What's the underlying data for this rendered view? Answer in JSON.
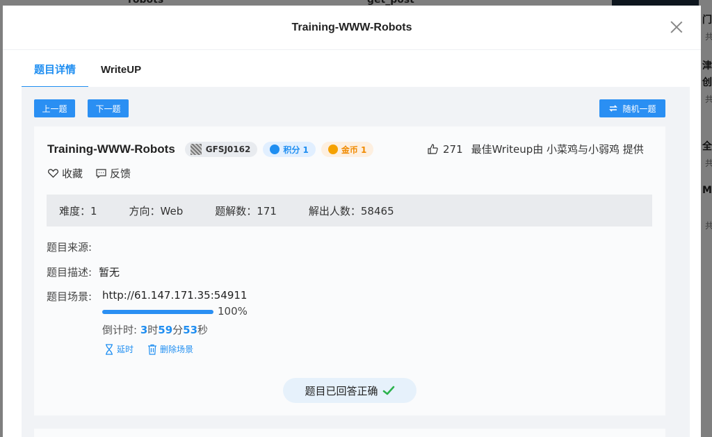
{
  "background": {
    "top_texts": [
      "robots",
      "get_post"
    ],
    "right_lines": [
      "门",
      "津",
      "创",
      "全",
      "M"
    ],
    "right_subs": [
      "共",
      "共",
      "共",
      "共"
    ]
  },
  "modal": {
    "title": "Training-WWW-Robots",
    "tabs": [
      {
        "label": "题目详情",
        "active": true
      },
      {
        "label": "WriteUP",
        "active": false
      }
    ],
    "toolbar": {
      "prev_label": "上一题",
      "next_label": "下一题",
      "random_label": "随机一题"
    },
    "challenge": {
      "name": "Training-WWW-Robots",
      "id": "GFSJ0162",
      "score_label": "积分 1",
      "coin_label": "金币 1",
      "likes": "271",
      "best_writeup": "最佳Writeup由 小菜鸡与小弱鸡 提供",
      "favorite_label": "收藏",
      "feedback_label": "反馈"
    },
    "stats": {
      "difficulty": "难度：1",
      "direction": "方向：Web",
      "solves": "题解数：171",
      "solvers": "解出人数：58465"
    },
    "info": {
      "source_label": "题目来源:",
      "source_value": "",
      "desc_label": "题目描述:",
      "desc_value": "暂无",
      "scene_label": "题目场景:",
      "scene_url": "http://61.147.171.35:54911",
      "progress": 1.0,
      "progress_text": "100%",
      "countdown_prefix": "倒计时: ",
      "countdown_h": "3",
      "countdown_h_unit": "时",
      "countdown_m": "59",
      "countdown_m_unit": "分",
      "countdown_s": "53",
      "countdown_s_unit": "秒",
      "extend_label": "延时",
      "delete_label": "删除场景"
    },
    "answered_label": "题目已回答正确"
  },
  "colors": {
    "accent": "#1f8ef1",
    "coin": "#f08a00",
    "check": "#2bb24c"
  }
}
